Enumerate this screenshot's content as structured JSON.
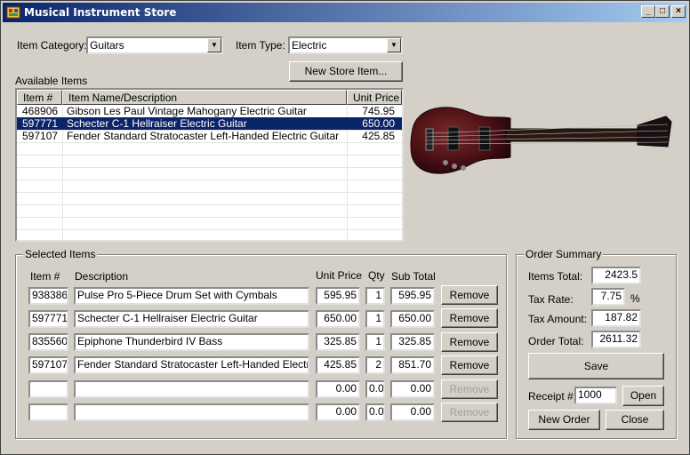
{
  "window": {
    "title": "Musical Instrument Store"
  },
  "filters": {
    "category_label": "Item Category:",
    "category_value": "Guitars",
    "type_label": "Item Type:",
    "type_value": "Electric",
    "new_item_button": "New Store Item..."
  },
  "available": {
    "label": "Available Items",
    "columns": [
      "Item #",
      "Item Name/Description",
      "Unit Price"
    ],
    "rows": [
      {
        "item": "468906",
        "desc": "Gibson Les Paul Vintage Mahogany Electric Guitar",
        "price": "745.95"
      },
      {
        "item": "597771",
        "desc": "Schecter C-1 Hellraiser Electric Guitar",
        "price": "650.00"
      },
      {
        "item": "597107",
        "desc": "Fender Standard Stratocaster Left-Handed Electric Guitar",
        "price": "425.85"
      }
    ],
    "selected_index": 1
  },
  "selected": {
    "title": "Selected Items",
    "headers": {
      "item": "Item #",
      "desc": "Description",
      "price": "Unit Price",
      "qty": "Qty",
      "sub": "Sub Total"
    },
    "remove_label": "Remove",
    "rows": [
      {
        "item": "938386",
        "desc": "Pulse Pro 5-Piece Drum Set with Cymbals",
        "price": "595.95",
        "qty": "1",
        "sub": "595.95"
      },
      {
        "item": "597771",
        "desc": "Schecter C-1 Hellraiser Electric Guitar",
        "price": "650.00",
        "qty": "1",
        "sub": "650.00"
      },
      {
        "item": "835560",
        "desc": "Epiphone Thunderbird IV Bass",
        "price": "325.85",
        "qty": "1",
        "sub": "325.85"
      },
      {
        "item": "597107",
        "desc": "Fender Standard Stratocaster Left-Handed Electric Gui",
        "price": "425.85",
        "qty": "2",
        "sub": "851.70"
      },
      {
        "item": "",
        "desc": "",
        "price": "0.00",
        "qty": "0.0",
        "sub": "0.00"
      },
      {
        "item": "",
        "desc": "",
        "price": "0.00",
        "qty": "0.0",
        "sub": "0.00"
      }
    ]
  },
  "summary": {
    "title": "Order Summary",
    "items_total_label": "Items Total:",
    "items_total": "2423.5",
    "tax_rate_label": "Tax Rate:",
    "tax_rate": "7.75",
    "tax_rate_unit": "%",
    "tax_amount_label": "Tax Amount:",
    "tax_amount": "187.82",
    "order_total_label": "Order Total:",
    "order_total": "2611.32",
    "save_button": "Save",
    "receipt_label": "Receipt #:",
    "receipt_value": "1000",
    "open_button": "Open",
    "new_order_button": "New Order",
    "close_button": "Close"
  }
}
